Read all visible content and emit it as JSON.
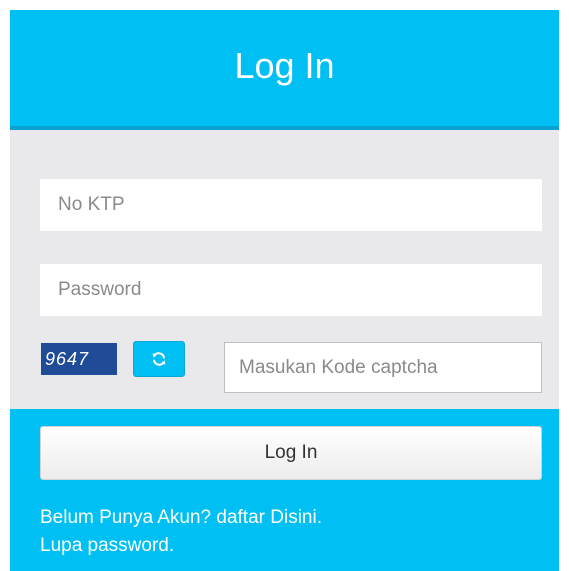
{
  "header": {
    "title": "Log In"
  },
  "form": {
    "ktp_placeholder": "No KTP",
    "password_placeholder": "Password",
    "captcha_code": "9647",
    "captcha_placeholder": "Masukan Kode captcha"
  },
  "footer": {
    "login_label": "Log In",
    "register_link": "Belum Punya Akun? daftar Disini.",
    "forgot_link": "Lupa password."
  },
  "icons": {
    "refresh": "refresh-icon"
  },
  "colors": {
    "accent": "#00bff3",
    "accent_dark": "#0aa0d2",
    "panel_bg": "#e9e9ec",
    "captcha_bg": "#1f4b97"
  }
}
